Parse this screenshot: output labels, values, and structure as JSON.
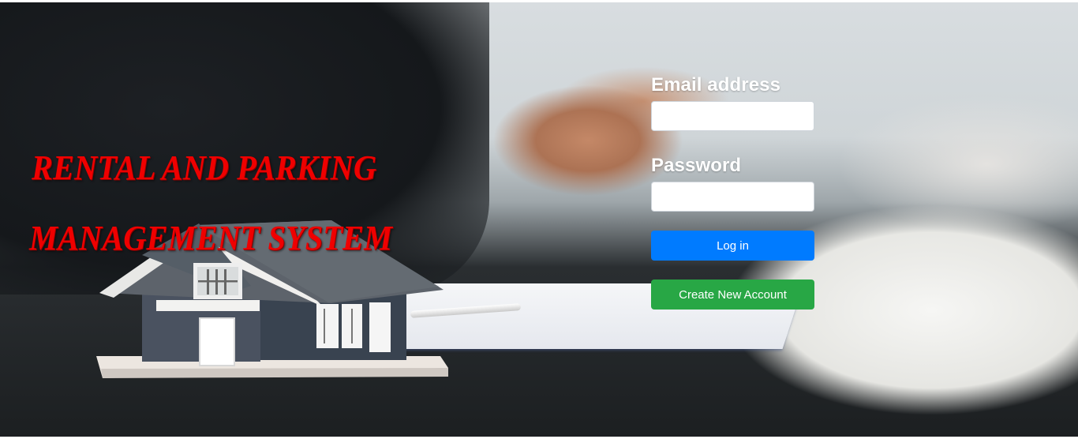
{
  "page": {
    "title_line1": "RENTAL AND PARKING",
    "title_line2": "MANAGEMENT SYSTEM"
  },
  "login_form": {
    "email_label": "Email address",
    "email_value": "",
    "password_label": "Password",
    "password_value": "",
    "login_button": "Log in",
    "create_button": "Create New Account"
  },
  "colors": {
    "title_red": "#ef0000",
    "login_blue": "#007bff",
    "create_green": "#28a745"
  }
}
